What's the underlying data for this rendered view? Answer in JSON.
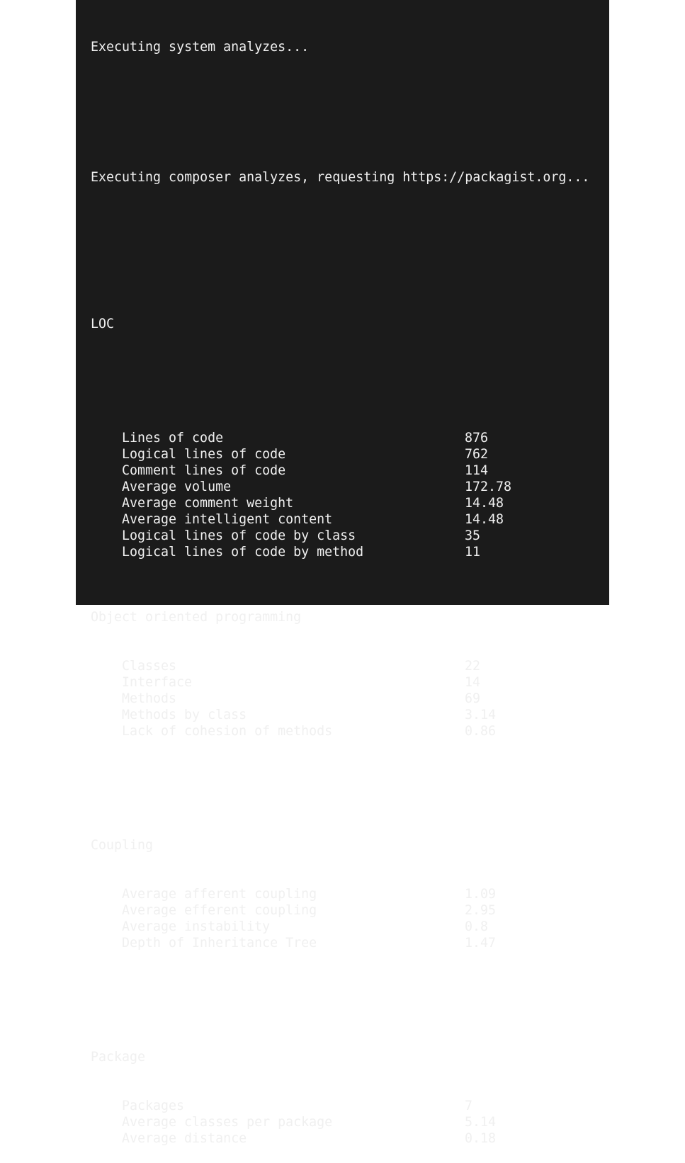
{
  "terminal": {
    "status_lines": [
      "Executing system analyzes...",
      "Executing composer analyzes, requesting https://packagist.org..."
    ],
    "sections": {
      "loc": {
        "title": "LOC",
        "metrics": [
          {
            "label": "Lines of code",
            "value": "876"
          },
          {
            "label": "Logical lines of code",
            "value": "762"
          },
          {
            "label": "Comment lines of code",
            "value": "114"
          },
          {
            "label": "Average volume",
            "value": "172.78"
          },
          {
            "label": "Average comment weight",
            "value": "14.48"
          },
          {
            "label": "Average intelligent content",
            "value": "14.48"
          },
          {
            "label": "Logical lines of code by class",
            "value": "35"
          },
          {
            "label": "Logical lines of code by method",
            "value": "11"
          }
        ]
      },
      "oop": {
        "title": "Object oriented programming",
        "metrics": [
          {
            "label": "Classes",
            "value": "22"
          },
          {
            "label": "Interface",
            "value": "14"
          },
          {
            "label": "Methods",
            "value": "69"
          },
          {
            "label": "Methods by class",
            "value": "3.14"
          },
          {
            "label": "Lack of cohesion of methods",
            "value": "0.86"
          }
        ]
      },
      "coupling": {
        "title": "Coupling",
        "metrics": [
          {
            "label": "Average afferent coupling",
            "value": "1.09"
          },
          {
            "label": "Average efferent coupling",
            "value": "2.95"
          },
          {
            "label": "Average instability",
            "value": "0.8"
          },
          {
            "label": "Depth of Inheritance Tree",
            "value": "1.47"
          }
        ]
      },
      "package": {
        "title": "Package",
        "metrics": [
          {
            "label": "Packages",
            "value": "7"
          },
          {
            "label": "Average classes per package",
            "value": "5.14"
          },
          {
            "label": "Average distance",
            "value": "0.18"
          }
        ]
      }
    }
  }
}
